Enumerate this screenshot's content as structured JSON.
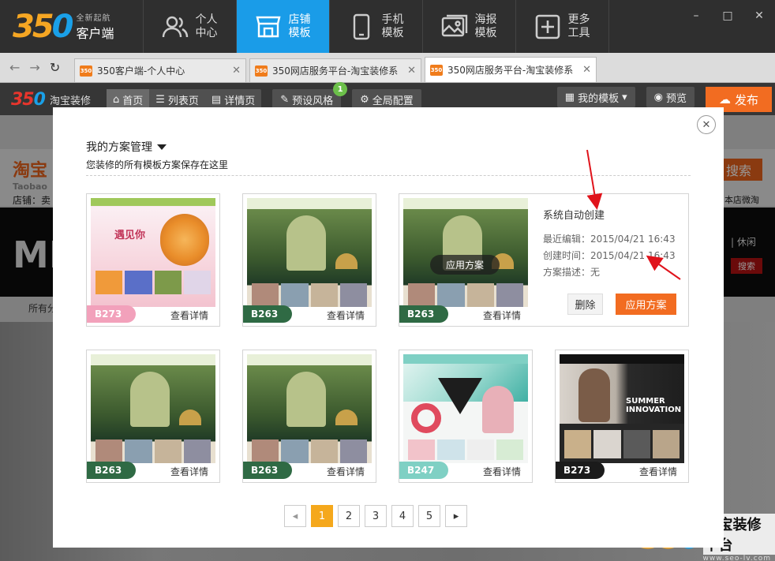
{
  "app": {
    "logo_mark_a": "35",
    "logo_mark_b": "0",
    "logo_sub": "全新起航",
    "logo_main": "客户端",
    "nav": [
      {
        "label": "个人中心",
        "icon": "users-icon"
      },
      {
        "label": "店铺模板",
        "icon": "shop-icon"
      },
      {
        "label": "手机模板",
        "icon": "phone-icon"
      },
      {
        "label": "海报模板",
        "icon": "image-icon"
      },
      {
        "label": "更多工具",
        "icon": "plus-box-icon"
      }
    ],
    "win": {
      "min": "–",
      "max": "□",
      "close": "✕"
    }
  },
  "browser": {
    "tabs": [
      {
        "fav": "350",
        "title": "350客户端-个人中心"
      },
      {
        "fav": "350",
        "title": "350网店服务平台-淘宝装修系"
      },
      {
        "fav": "350",
        "title": "350网店服务平台-淘宝装修系"
      }
    ]
  },
  "toolbar": {
    "logo_a": "35",
    "logo_b": "0",
    "logo_text": "淘宝装修",
    "home": "首页",
    "list": "列表页",
    "detail": "详情页",
    "preset": "预设风格",
    "preset_badge": "1",
    "global": "全局配置",
    "my_template": "我的模板",
    "preview": "预览",
    "publish": "发布"
  },
  "background": {
    "taobao": "淘宝",
    "taobao_en": "Taobao",
    "search": "搜索",
    "shop_label": "店铺：卖",
    "weitao": "本店微淘",
    "me": "ME",
    "xiuxian": "| 休闲",
    "sousuo": "搜索",
    "all_cat": "所有分"
  },
  "modal": {
    "title": "我的方案管理",
    "subtitle": "您装修的所有模板方案保存在这里",
    "close": "✕",
    "view_detail": "查看详情",
    "cards": [
      {
        "tag": "B273",
        "color": "#f2a1bb"
      },
      {
        "tag": "B263",
        "color": "#2f6a44"
      },
      {
        "tag": "B263",
        "color": "#2f6a44"
      },
      {
        "tag": "B263",
        "color": "#2f6a44"
      },
      {
        "tag": "B263",
        "color": "#2f6a44"
      },
      {
        "tag": "B247",
        "color": "#7fd0c4"
      },
      {
        "tag": "B273",
        "color": "#1b1b1b"
      }
    ],
    "info": {
      "title": "系统自动创建",
      "edit_label": "最近编辑：",
      "edit_time": "2015/04/21 16:43",
      "create_label": "创建时间：",
      "create_time": "2015/04/21 16:43",
      "desc_label": "方案描述：",
      "desc_value": "无",
      "delete": "删除",
      "apply": "应用方案",
      "overlay_apply": "应用方案"
    },
    "pager": {
      "prev": "◂",
      "next": "▸",
      "pages": [
        "1",
        "2",
        "3",
        "4",
        "5"
      ],
      "current": "1"
    }
  },
  "watermark": {
    "mark_a": "35",
    "mark_b": "0",
    "title": "淘宝装修平台",
    "url": "www.seo-lv.com"
  }
}
